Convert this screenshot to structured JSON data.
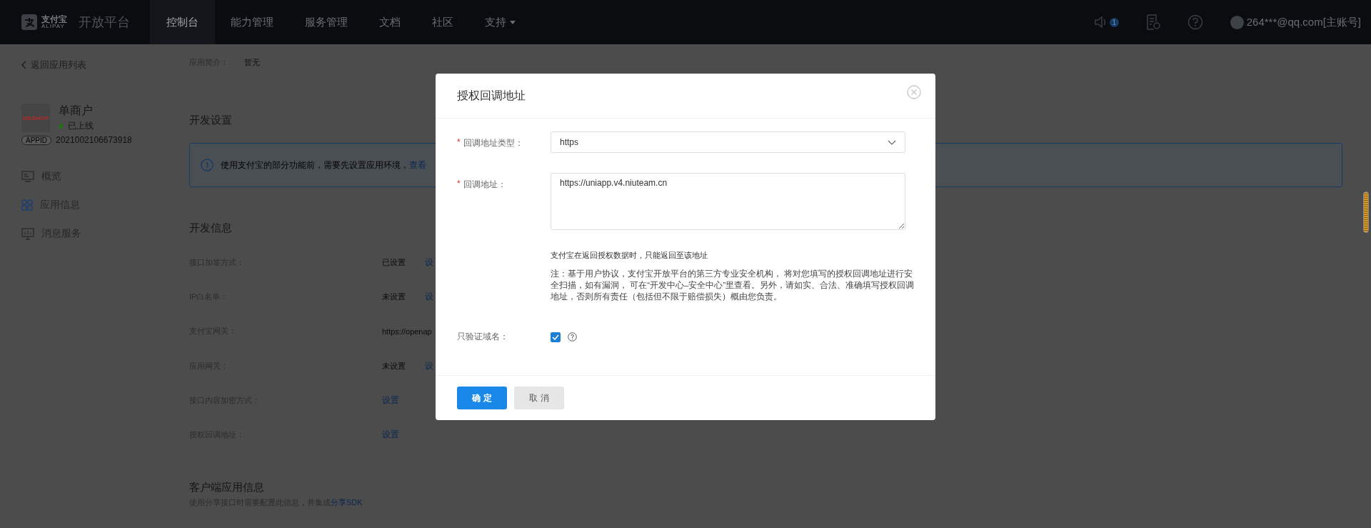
{
  "nav": {
    "logo_mark": "支付宝",
    "logo_sub": "ALIPAY",
    "title": "开放平台",
    "items": [
      {
        "label": "控制台",
        "selected": true,
        "dropdown": false
      },
      {
        "label": "能力管理",
        "selected": false,
        "dropdown": false
      },
      {
        "label": "服务管理",
        "selected": false,
        "dropdown": false
      },
      {
        "label": "文档",
        "selected": false,
        "dropdown": false
      },
      {
        "label": "社区",
        "selected": false,
        "dropdown": false
      },
      {
        "label": "支持",
        "selected": false,
        "dropdown": true
      }
    ],
    "notification_count": "1",
    "account": "264***@qq.com[主账号]"
  },
  "sidebar": {
    "back": "返回应用列表",
    "app": {
      "logo_text": "NIUSHOP",
      "name": "单商户",
      "status": "已上线",
      "appid_label": "APPID",
      "appid": "2021002106673918"
    },
    "items": [
      {
        "label": "概览",
        "kind": "monitor",
        "selected": false
      },
      {
        "label": "应用信息",
        "kind": "grid",
        "selected": true
      },
      {
        "label": "消息服务",
        "kind": "chart",
        "selected": false
      }
    ]
  },
  "main": {
    "intro_label": "应用简介：",
    "intro_value": "暂无",
    "dev_settings": {
      "title": "开发设置",
      "notice": "使用支付宝的部分功能前，需要先设置应用环境，",
      "notice_link": "查看"
    },
    "dev_info": {
      "title": "开发信息",
      "rows": [
        {
          "label": "接口加签方式：",
          "value": "已设置",
          "link": "设"
        },
        {
          "label": "IP白名单：",
          "value": "未设置",
          "link": "设"
        },
        {
          "label": "支付宝网关：",
          "value": "https://openap"
        },
        {
          "label": "应用网关：",
          "value": "未设置",
          "link": "设"
        },
        {
          "label": "接口内容加密方式：",
          "link": "设置"
        },
        {
          "label": "授权回调地址：",
          "link": "设置"
        }
      ]
    },
    "client": {
      "title": "客户端应用信息",
      "text": "使用分享接口时需要配置此信息，并集成",
      "link": "分享SDK"
    }
  },
  "modal": {
    "title": "授权回调地址",
    "required_mark": "*",
    "fields": [
      {
        "kind": "select",
        "label": "回调地址类型：",
        "required": true,
        "value": "https"
      },
      {
        "kind": "textarea",
        "label": "回调地址：",
        "required": true,
        "value": "https://uniapp.v4.niuteam.cn"
      }
    ],
    "hint": "支付宝在返回授权数据时，只能返回至该地址",
    "note": "注：基于用户协议，支付宝开放平台的第三方专业安全机构， 将对您填写的授权回调地址进行安全扫描，如有漏洞， 可在“开发中心–安全中心”里查看。另外，请如实、合法、准确填写授权回调地址，否则所有责任（包括但不限于赔偿损失）概由您负责。",
    "domain_only": {
      "label": "只验证域名：",
      "checked": true
    },
    "buttons": [
      {
        "label": "确 定",
        "kind": "primary"
      },
      {
        "label": "取 消",
        "kind": "default"
      }
    ]
  }
}
